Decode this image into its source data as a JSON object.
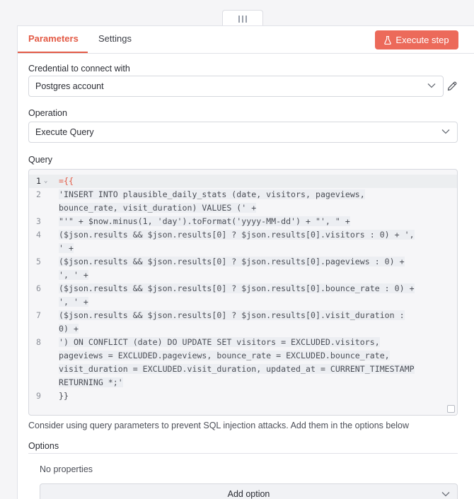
{
  "tabs": {
    "parameters": "Parameters",
    "settings": "Settings"
  },
  "execute_button": "Execute step",
  "credential": {
    "label": "Credential to connect with",
    "value": "Postgres account"
  },
  "operation": {
    "label": "Operation",
    "value": "Execute Query"
  },
  "query": {
    "label": "Query",
    "lines": [
      {
        "num": "1",
        "rows": [
          "={{"
        ]
      },
      {
        "num": "2",
        "rows": [
          "'INSERT INTO plausible_daily_stats (date, visitors, pageviews,",
          "bounce_rate, visit_duration) VALUES (' +"
        ]
      },
      {
        "num": "3",
        "rows": [
          "\"'\" + $now.minus(1, 'day').toFormat('yyyy-MM-dd') + \"', \" +"
        ]
      },
      {
        "num": "4",
        "rows": [
          "($json.results && $json.results[0] ? $json.results[0].visitors : 0) + ',",
          "' +"
        ]
      },
      {
        "num": "5",
        "rows": [
          "($json.results && $json.results[0] ? $json.results[0].pageviews : 0) +",
          "', ' +"
        ]
      },
      {
        "num": "6",
        "rows": [
          "($json.results && $json.results[0] ? $json.results[0].bounce_rate : 0) +",
          "', ' +"
        ]
      },
      {
        "num": "7",
        "rows": [
          "($json.results && $json.results[0] ? $json.results[0].visit_duration :",
          "0) +"
        ]
      },
      {
        "num": "8",
        "rows": [
          "') ON CONFLICT (date) DO UPDATE SET visitors = EXCLUDED.visitors,",
          "pageviews = EXCLUDED.pageviews, bounce_rate = EXCLUDED.bounce_rate,",
          "visit_duration = EXCLUDED.visit_duration, updated_at = CURRENT_TIMESTAMP",
          "RETURNING *;'"
        ]
      },
      {
        "num": "9",
        "rows": [
          "}}"
        ]
      }
    ]
  },
  "hint": "Consider using query parameters to prevent SQL injection attacks. Add them in the options below",
  "options": {
    "title": "Options",
    "empty": "No properties",
    "add_label": "Add option"
  },
  "colors": {
    "accent": "#e35a45",
    "button": "#ec6a5a"
  },
  "icons": {
    "execute": "flask-icon",
    "edit": "pencil-icon",
    "chevron": "chevron-down-icon"
  }
}
